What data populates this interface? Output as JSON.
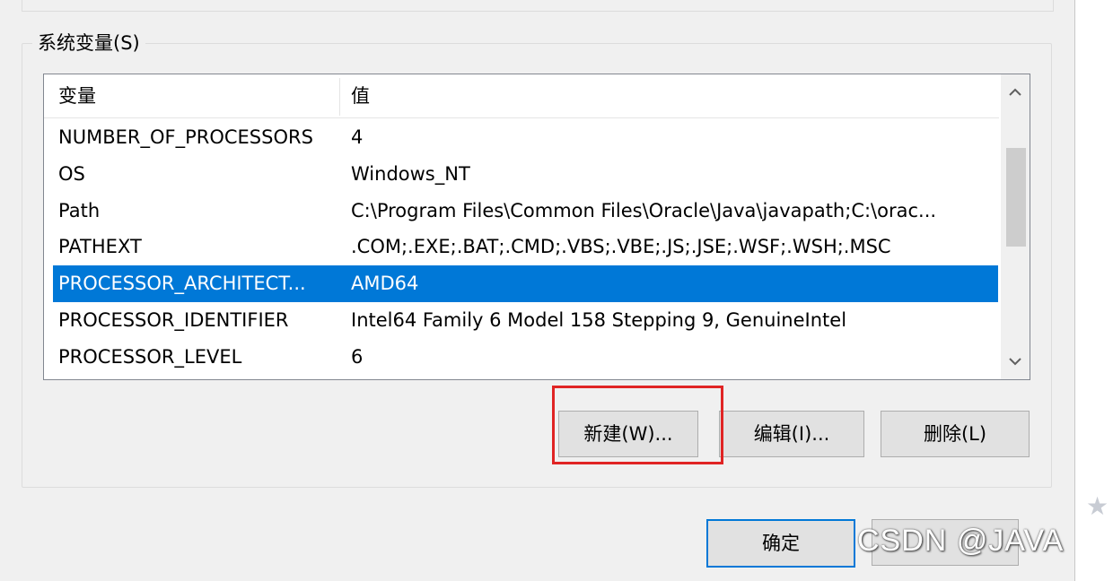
{
  "group": {
    "title": "系统变量(S)"
  },
  "list": {
    "headers": {
      "variable": "变量",
      "value": "值"
    },
    "rows": [
      {
        "variable": "NUMBER_OF_PROCESSORS",
        "value": "4",
        "selected": false
      },
      {
        "variable": "OS",
        "value": "Windows_NT",
        "selected": false
      },
      {
        "variable": "Path",
        "value": "C:\\Program Files\\Common Files\\Oracle\\Java\\javapath;C:\\orac...",
        "selected": false
      },
      {
        "variable": "PATHEXT",
        "value": ".COM;.EXE;.BAT;.CMD;.VBS;.VBE;.JS;.JSE;.WSF;.WSH;.MSC",
        "selected": false
      },
      {
        "variable": "PROCESSOR_ARCHITECT...",
        "value": "AMD64",
        "selected": true
      },
      {
        "variable": "PROCESSOR_IDENTIFIER",
        "value": "Intel64 Family 6 Model 158 Stepping 9, GenuineIntel",
        "selected": false
      },
      {
        "variable": "PROCESSOR_LEVEL",
        "value": "6",
        "selected": false
      }
    ]
  },
  "buttons": {
    "new": "新建(W)...",
    "edit": "编辑(I)...",
    "delete": "删除(L)",
    "ok": "确定"
  },
  "watermark": "CSDN @JAVA"
}
